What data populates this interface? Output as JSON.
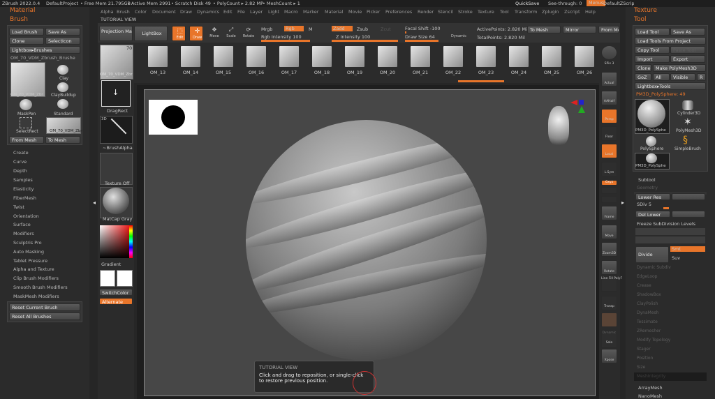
{
  "titlebar": {
    "app": "ZBrush 2022.0.4",
    "project": "DefaultProject",
    "free_mem": "• Free Mem 21.795GB",
    "active_mem": "• Active Mem 2991",
    "scratch": "• Scratch Disk 49",
    "polycount": "• PolyCount ▸ 2.82 MP",
    "meshcount": "• MeshCount ▸ 1",
    "quicksave": "QuickSave",
    "see_through": "See-through: 0",
    "menus": "Menus",
    "script": "DefaultZScript"
  },
  "menubar": [
    "Alpha",
    "Brush",
    "Color",
    "Document",
    "Draw",
    "Dynamics",
    "Edit",
    "File",
    "Layer",
    "Light",
    "Macro",
    "Marker",
    "Material",
    "Movie",
    "Picker",
    "Preferences",
    "Render",
    "Stencil",
    "Stroke",
    "Texture",
    "Tool",
    "Transform",
    "Zplugin",
    "Zscript",
    "Help"
  ],
  "left_panel": {
    "title_material": "Material",
    "title_brush": "Brush",
    "load_brush": "Load Brush",
    "save_as": "Save As",
    "clone": "Clone",
    "select_icon": "SelectIcon",
    "lightbox_brushes": "Lightbox▸Brushes",
    "current_brush": "OM_70_VDM_Zbrush_Brushe",
    "brushes": [
      "Clay",
      "ClayBuildup",
      "MaskPen",
      "Standard",
      "SelectRect",
      "OM_70_VDM_Zbr"
    ],
    "current_brush_short": "OM_70_VDM_Zbr",
    "from_mesh": "From Mesh",
    "to_mesh": "To Mesh",
    "sections": [
      "Create",
      "Curve",
      "Depth",
      "Samples",
      "Elasticity",
      "FiberMesh",
      "Twist",
      "Orientation",
      "Surface",
      "Modifiers",
      "Sculptris Pro",
      "Auto Masking",
      "Tablet Pressure",
      "Alpha and Texture",
      "Clip Brush Modifiers",
      "Smooth Brush Modifiers",
      "MaskMesh Modifiers"
    ],
    "reset_current": "Reset Current Brush",
    "reset_all": "Reset All Brushes"
  },
  "tutorial_label": "TUTORIAL VIEW",
  "shelf": {
    "projection_master": "Projection Master",
    "lightbox": "LightBox",
    "edit": "Edit",
    "draw": "Draw",
    "move": "Move",
    "scale": "Scale",
    "rotate": "Rotate",
    "mrgb": "Mrgb",
    "rgb": "Rgb",
    "m": "M",
    "zadd": "Zadd",
    "zsub": "Zsub",
    "zcut": "Zcut",
    "rgb_intensity": "Rgb Intensity 100",
    "z_intensity": "Z Intensity 100",
    "focal_shift": "Focal Shift -100",
    "draw_size": "Draw Size 64",
    "dynamic": "Dynamic",
    "active_points": "ActivePoints: 2.820 Mil",
    "total_points": "TotalPoints: 2.820 Mil",
    "to_mesh": "To Mesh",
    "mirror": "Mirror",
    "from_mesh": "From Me"
  },
  "brush_strip": {
    "current": "OM_70_VDM_Zbr",
    "badge": "70",
    "items": [
      "OM_13",
      "OM_14",
      "OM_15",
      "OM_16",
      "OM_17",
      "OM_18",
      "OM_19",
      "OM_20",
      "OM_21",
      "OM_22",
      "OM_23",
      "OM_24",
      "OM_25",
      "OM_26"
    ]
  },
  "palette_column": {
    "drag_rect": "DragRect",
    "brush_alpha": "~BrushAlpha",
    "texture_off": "Texture Off",
    "matcap": "MatCap Gray",
    "gradient": "Gradient",
    "switch_color": "SwitchColor",
    "alternate": "Alternate",
    "stroke_badge": "3D"
  },
  "right_toolbar": [
    "SPix 3",
    "Actual",
    "AAHalf",
    "Persp",
    "Floor",
    "Local",
    "L.Sym",
    "Gxyz",
    "",
    "",
    "Frame",
    "Move",
    "Zoom3D",
    "Rotate",
    "Line Fill PolyF",
    "Transp",
    "",
    "Dynamic",
    "Solo",
    "Xpose"
  ],
  "tool_panel": {
    "title_texture": "Texture",
    "title_tool": "Tool",
    "load_tool": "Load Tool",
    "save_as": "Save As",
    "load_from_project": "Load Tools From Project",
    "copy_tool": "Copy Tool",
    "paste_tool": "Paste Tool",
    "import": "Import",
    "export": "Export",
    "clone": "Clone",
    "make_polymesh": "Make PolyMesh3D",
    "goz": "GoZ",
    "all": "All",
    "visible": "Visible",
    "r": "R",
    "lightbox_tools": "Lightbox▸Tools",
    "current_tool": "PM3D_PolySphere: 49",
    "tools": [
      "PM3D_PolySphe",
      "Cylinder3D",
      "PolyMesh3D",
      "PolySphere",
      "SimpleBrush",
      "PM3D_PolySphe"
    ],
    "subtool": "Subtool",
    "geometry": "Geometry",
    "lower_res": "Lower Res",
    "sdiv": "SDiv 5",
    "del_lower": "Del Lower",
    "freeze": "Freeze SubDivision Levels",
    "divide": "Divide",
    "smt": "Smt",
    "suv": "Suv",
    "dim_sections": [
      "Dynamic Subdiv",
      "EdgeLoop",
      "Crease",
      "ShadowBox",
      "ClayPolish",
      "DynaMesh",
      "Tessimate",
      "ZRemesher",
      "Modify Topology",
      "Stager",
      "Position",
      "Size",
      "MeshIntegrity"
    ],
    "array_mesh": "ArrayMesh",
    "nano_mesh": "NanoMesh"
  },
  "tooltip": {
    "title": "TUTORIAL VIEW",
    "line1": "Click and drag to reposition, or single-click",
    "line2": "to restore previous position."
  },
  "colors": {
    "accent": "#e8752a",
    "bg": "#262626",
    "panel": "#2e2e2e",
    "button": "#4d4d4d"
  }
}
